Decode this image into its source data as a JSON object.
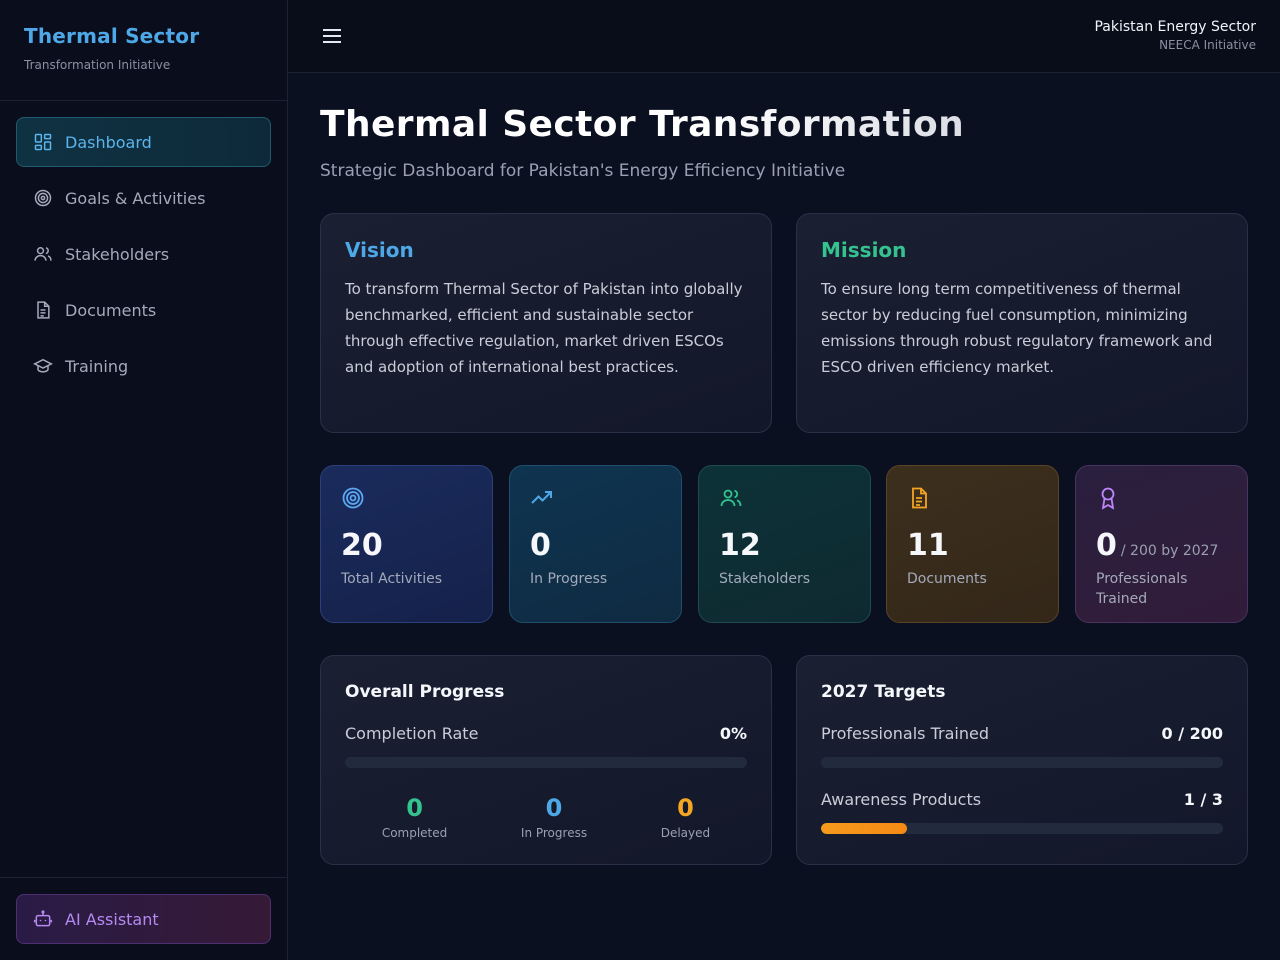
{
  "sidebar": {
    "brand_title": "Thermal Sector",
    "brand_sub": "Transformation Initiative",
    "items": [
      {
        "label": "Dashboard",
        "icon": "dashboard-icon"
      },
      {
        "label": "Goals & Activities",
        "icon": "target-icon"
      },
      {
        "label": "Stakeholders",
        "icon": "users-icon"
      },
      {
        "label": "Documents",
        "icon": "document-icon"
      },
      {
        "label": "Training",
        "icon": "graduation-cap-icon"
      }
    ],
    "ai_label": "AI Assistant"
  },
  "header": {
    "org": "Pakistan Energy Sector",
    "initiative": "NEECA Initiative"
  },
  "main": {
    "title": "Thermal Sector Transformation",
    "subtitle": "Strategic Dashboard for Pakistan's Energy Efficiency Initiative",
    "vision": {
      "heading": "Vision",
      "text": "To transform Thermal Sector of Pakistan into globally benchmarked, efficient and sustainable sector through effective regulation, market driven ESCOs and adoption of international best practices."
    },
    "mission": {
      "heading": "Mission",
      "text": "To ensure long term competitiveness of thermal sector by reducing fuel consumption, minimizing emissions through robust regulatory framework and ESCO driven efficiency market."
    },
    "stats": [
      {
        "value": "20",
        "label": "Total Activities",
        "icon": "target-icon"
      },
      {
        "value": "0",
        "label": "In Progress",
        "icon": "trending-up-icon"
      },
      {
        "value": "12",
        "label": "Stakeholders",
        "icon": "users-icon"
      },
      {
        "value": "11",
        "label": "Documents",
        "icon": "document-icon"
      },
      {
        "value": "0",
        "suffix": "/ 200 by 2027",
        "label": "Professionals Trained",
        "icon": "award-icon"
      }
    ],
    "overall": {
      "heading": "Overall Progress",
      "rate_label": "Completion Rate",
      "rate_value": "0%",
      "rate_fraction": 0,
      "completed": {
        "value": "0",
        "label": "Completed"
      },
      "in_progress": {
        "value": "0",
        "label": "In Progress"
      },
      "delayed": {
        "value": "0",
        "label": "Delayed"
      }
    },
    "targets": {
      "heading": "2027 Targets",
      "professionals": {
        "label": "Professionals Trained",
        "value": "0 / 200",
        "fraction": 0
      },
      "awareness": {
        "label": "Awareness Products",
        "value": "1 / 3",
        "fraction": 0.2143
      }
    }
  },
  "colors": {
    "accent_blue": "#4ea8e8",
    "accent_green": "#34c38f",
    "accent_amber": "#f5a524",
    "accent_purple": "#b48af0"
  }
}
